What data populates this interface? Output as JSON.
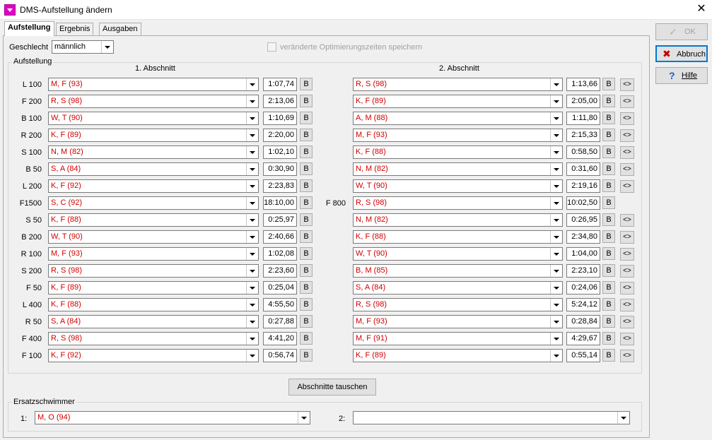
{
  "window": {
    "title": "DMS-Aufstellung ändern",
    "close_glyph": "✕"
  },
  "tabs": [
    {
      "label": "Aufstellung",
      "active": true
    },
    {
      "label": "Ergebnis",
      "active": false
    },
    {
      "label": "Ausgaben",
      "active": false
    }
  ],
  "gender": {
    "label": "Geschlecht",
    "value": "männlich"
  },
  "save_times": {
    "label": "veränderte Optimierungszeiten speichern",
    "checked": false,
    "enabled": false
  },
  "lineup": {
    "legend": "Aufstellung",
    "section1_header": "1. Abschnitt",
    "section2_header": "2. Abschnitt",
    "b_label": "B",
    "swap_label": "<>",
    "rows": [
      {
        "event": "L 100",
        "s1_swimmer": "M, F (93)",
        "s1_time": "1:07,74",
        "s2_swimmer": "R, S (98)",
        "s2_time": "1:13,66",
        "swap": true
      },
      {
        "event": "F 200",
        "s1_swimmer": "R, S (98)",
        "s1_time": "2:13,06",
        "s2_swimmer": "K, F (89)",
        "s2_time": "2:05,00",
        "swap": true
      },
      {
        "event": "B 100",
        "s1_swimmer": "W, T (90)",
        "s1_time": "1:10,69",
        "s2_swimmer": "A, M (88)",
        "s2_time": "1:11,80",
        "swap": true
      },
      {
        "event": "R 200",
        "s1_swimmer": "K, F (89)",
        "s1_time": "2:20,00",
        "s2_swimmer": "M, F (93)",
        "s2_time": "2:15,33",
        "swap": true
      },
      {
        "event": "S 100",
        "s1_swimmer": "N, M (82)",
        "s1_time": "1:02,10",
        "s2_swimmer": "K, F (88)",
        "s2_time": "0:58,50",
        "swap": true
      },
      {
        "event": "B  50",
        "s1_swimmer": "S, A (84)",
        "s1_time": "0:30,90",
        "s2_swimmer": "N, M (82)",
        "s2_time": "0:31,60",
        "swap": true
      },
      {
        "event": "L 200",
        "s1_swimmer": "K, F (92)",
        "s1_time": "2:23,83",
        "s2_swimmer": "W, T (90)",
        "s2_time": "2:19,16",
        "swap": true
      },
      {
        "event": "F1500",
        "s2_event": "F 800",
        "s1_swimmer": "S, C (92)",
        "s1_time": "18:10,00",
        "s2_swimmer": "R, S (98)",
        "s2_time": "10:02,50",
        "swap": false
      },
      {
        "event": "S  50",
        "s1_swimmer": "K, F (88)",
        "s1_time": "0:25,97",
        "s2_swimmer": "N, M (82)",
        "s2_time": "0:26,95",
        "swap": true
      },
      {
        "event": "B 200",
        "s1_swimmer": "W, T (90)",
        "s1_time": "2:40,66",
        "s2_swimmer": "K, F (88)",
        "s2_time": "2:34,80",
        "swap": true
      },
      {
        "event": "R 100",
        "s1_swimmer": "M, F (93)",
        "s1_time": "1:02,08",
        "s2_swimmer": "W, T (90)",
        "s2_time": "1:04,00",
        "swap": true
      },
      {
        "event": "S 200",
        "s1_swimmer": "R, S (98)",
        "s1_time": "2:23,60",
        "s2_swimmer": "B, M (85)",
        "s2_time": "2:23,10",
        "swap": true
      },
      {
        "event": "F  50",
        "s1_swimmer": "K, F (89)",
        "s1_time": "0:25,04",
        "s2_swimmer": "S, A (84)",
        "s2_time": "0:24,06",
        "swap": true
      },
      {
        "event": "L 400",
        "s1_swimmer": "K, F (88)",
        "s1_time": "4:55,50",
        "s2_swimmer": "R, S (98)",
        "s2_time": "5:24,12",
        "swap": true
      },
      {
        "event": "R  50",
        "s1_swimmer": "S, A (84)",
        "s1_time": "0:27,88",
        "s2_swimmer": "M, F (93)",
        "s2_time": "0:28,84",
        "swap": true
      },
      {
        "event": "F 400",
        "s1_swimmer": "R, S (98)",
        "s1_time": "4:41,20",
        "s2_swimmer": "M, F (91)",
        "s2_time": "4:29,67",
        "swap": true
      },
      {
        "event": "F 100",
        "s1_swimmer": "K, F (92)",
        "s1_time": "0:56,74",
        "s2_swimmer": "K, F (89)",
        "s2_time": "0:55,14",
        "swap": true
      }
    ]
  },
  "swap_sections_button": "Abschnitte tauschen",
  "substitutes": {
    "legend": "Ersatzschwimmer",
    "slot1_label": "1:",
    "slot1_value": "M, O (94)",
    "slot2_label": "2:",
    "slot2_value": ""
  },
  "buttons": {
    "ok": {
      "label": "OK",
      "icon": "check-icon",
      "enabled": false
    },
    "cancel": {
      "label": "Abbruch",
      "icon": "red-x-icon"
    },
    "help": {
      "label": "Hilfe",
      "icon": "question-icon"
    }
  },
  "colors": {
    "swimmer_text": "#d00000",
    "focus_border": "#0078d7",
    "help_icon": "#1060d0",
    "cancel_icon": "#c00000"
  }
}
